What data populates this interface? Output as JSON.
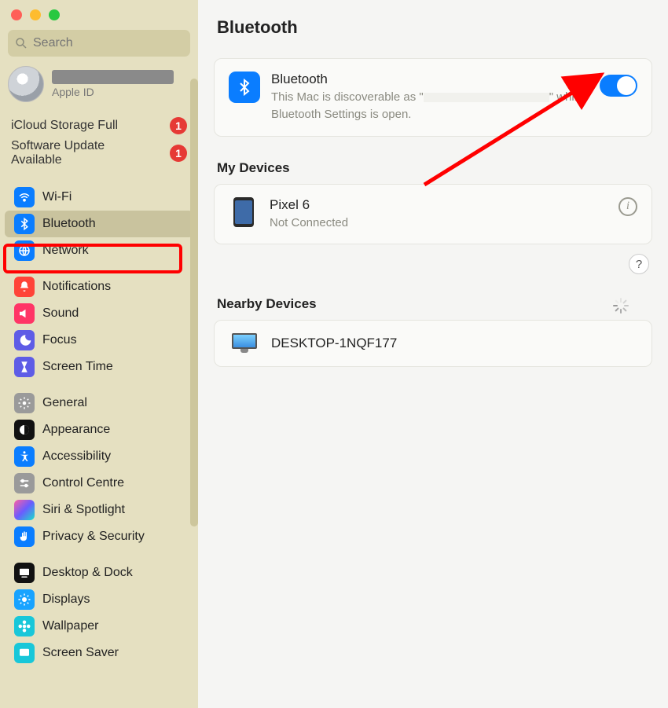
{
  "window": {
    "title": "Bluetooth"
  },
  "search": {
    "placeholder": "Search"
  },
  "profile": {
    "label": "Apple ID"
  },
  "alerts": [
    {
      "label": "iCloud Storage Full",
      "count": "1"
    },
    {
      "label": "Software Update Available",
      "count": "1"
    }
  ],
  "sidebar": {
    "group1": [
      {
        "name": "wifi",
        "label": "Wi-Fi",
        "color": "#0a7dff"
      },
      {
        "name": "bluetooth",
        "label": "Bluetooth",
        "color": "#0a7dff",
        "selected": true
      },
      {
        "name": "network",
        "label": "Network",
        "color": "#0a7dff"
      }
    ],
    "group2": [
      {
        "name": "notifications",
        "label": "Notifications",
        "color": "#ff4438"
      },
      {
        "name": "sound",
        "label": "Sound",
        "color": "#ff3566"
      },
      {
        "name": "focus",
        "label": "Focus",
        "color": "#5e5ce6"
      },
      {
        "name": "screentime",
        "label": "Screen Time",
        "color": "#5e5ce6"
      }
    ],
    "group3": [
      {
        "name": "general",
        "label": "General",
        "color": "#9a9a9a"
      },
      {
        "name": "appearance",
        "label": "Appearance",
        "color": "#111111"
      },
      {
        "name": "accessibility",
        "label": "Accessibility",
        "color": "#0a7dff"
      },
      {
        "name": "controlcentre",
        "label": "Control Centre",
        "color": "#9a9a9a"
      },
      {
        "name": "siri",
        "label": "Siri & Spotlight",
        "color": "#222222"
      },
      {
        "name": "privacy",
        "label": "Privacy & Security",
        "color": "#0a7dff"
      }
    ],
    "group4": [
      {
        "name": "desktop",
        "label": "Desktop & Dock",
        "color": "#111111"
      },
      {
        "name": "displays",
        "label": "Displays",
        "color": "#18a3ff"
      },
      {
        "name": "wallpaper",
        "label": "Wallpaper",
        "color": "#18c7d9"
      },
      {
        "name": "screensaver",
        "label": "Screen Saver",
        "color": "#18c7d9"
      }
    ]
  },
  "bluetoothCard": {
    "heading": "Bluetooth",
    "desc_pre": "This Mac is discoverable as \"",
    "desc_post": "\" while Bluetooth Settings is open.",
    "toggle_on": true
  },
  "myDevices": {
    "heading": "My Devices",
    "items": [
      {
        "name": "Pixel 6",
        "status": "Not Connected"
      }
    ]
  },
  "nearby": {
    "heading": "Nearby Devices",
    "items": [
      {
        "name": "DESKTOP-1NQF177"
      }
    ]
  },
  "help": "?"
}
